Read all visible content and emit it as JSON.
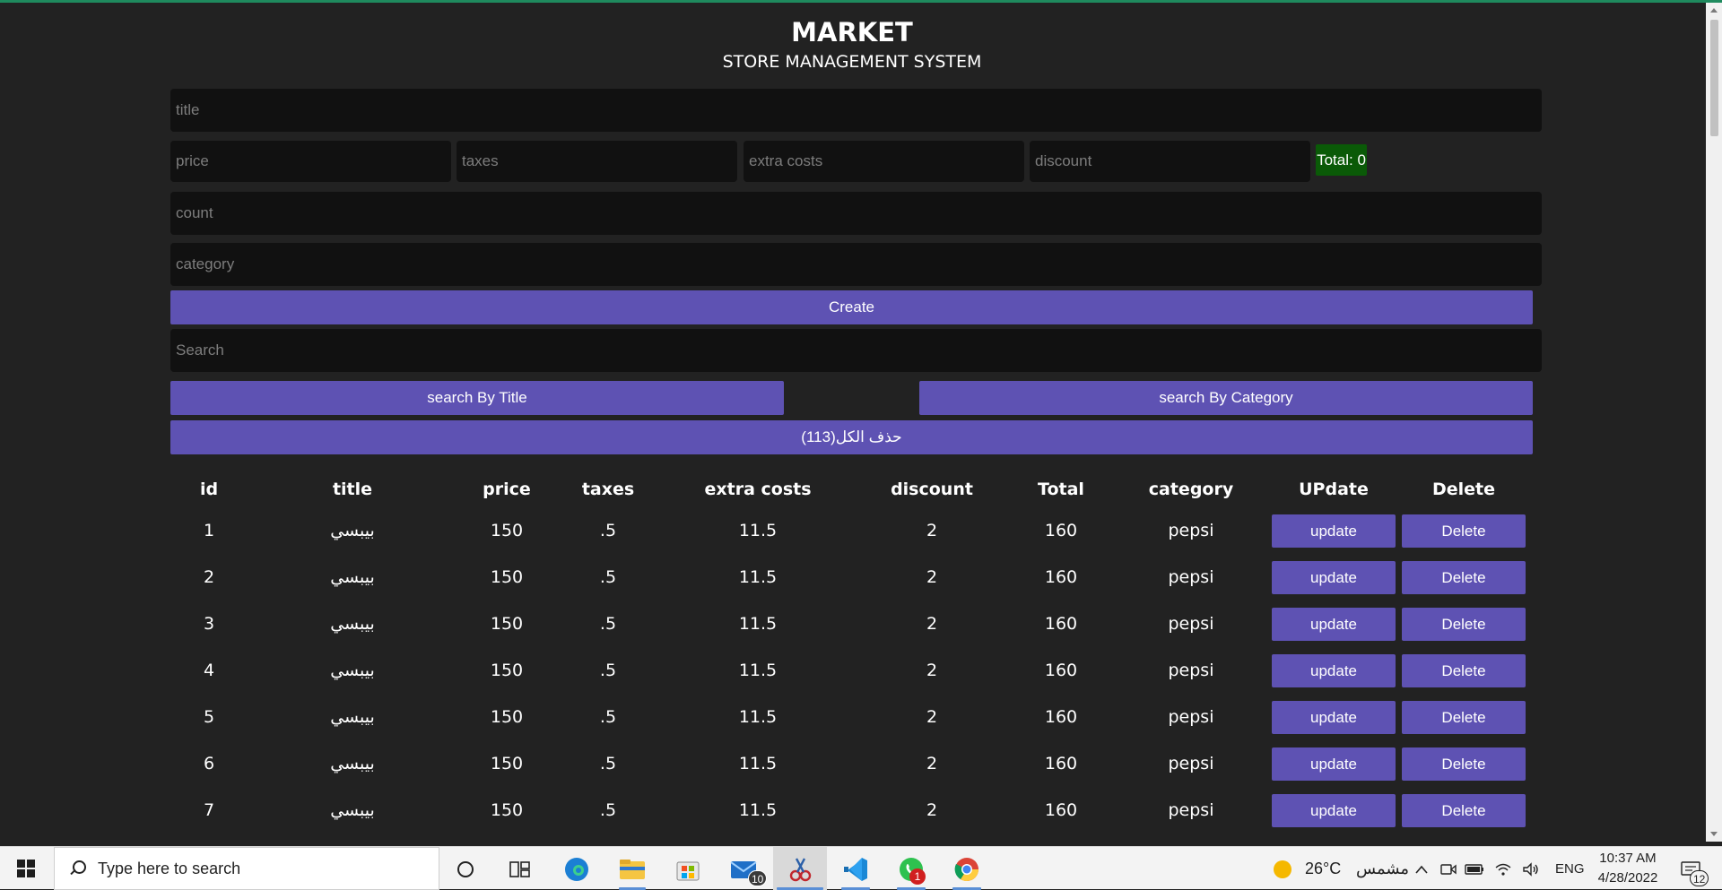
{
  "header": {
    "title": "MARKET",
    "subtitle": "STORE MANAGEMENT SYSTEM"
  },
  "form": {
    "title_placeholder": "title",
    "price_placeholder": "price",
    "taxes_placeholder": "taxes",
    "extra_costs_placeholder": "extra costs",
    "discount_placeholder": "discount",
    "total_label": "Total: 0",
    "count_placeholder": "count",
    "category_placeholder": "category",
    "create_label": "Create",
    "search_placeholder": "Search",
    "search_by_title_label": "search By Title",
    "search_by_category_label": "search By Category",
    "delete_all_label": "حذف الكل(113)"
  },
  "colors": {
    "background": "#222222",
    "input_bg": "#111111",
    "button": "#5e52b3",
    "total_bg": "#0a5a07"
  },
  "table": {
    "headers": [
      "id",
      "title",
      "price",
      "taxes",
      "extra costs",
      "discount",
      "Total",
      "category",
      "UPdate",
      "Delete"
    ],
    "update_label": "update",
    "delete_label": "Delete",
    "rows": [
      [
        "1",
        "بيبسي",
        "150",
        ".5",
        "11.5",
        "2",
        "160",
        "pepsi"
      ],
      [
        "2",
        "بيبسي",
        "150",
        ".5",
        "11.5",
        "2",
        "160",
        "pepsi"
      ],
      [
        "3",
        "بيبسي",
        "150",
        ".5",
        "11.5",
        "2",
        "160",
        "pepsi"
      ],
      [
        "4",
        "بيبسي",
        "150",
        ".5",
        "11.5",
        "2",
        "160",
        "pepsi"
      ],
      [
        "5",
        "بيبسي",
        "150",
        ".5",
        "11.5",
        "2",
        "160",
        "pepsi"
      ],
      [
        "6",
        "بيبسي",
        "150",
        ".5",
        "11.5",
        "2",
        "160",
        "pepsi"
      ],
      [
        "7",
        "بيبسي",
        "150",
        ".5",
        "11.5",
        "2",
        "160",
        "pepsi"
      ]
    ]
  },
  "taskbar": {
    "search_placeholder": "Type here to search",
    "apps": [
      "cortana-icon",
      "task-view-icon",
      "edge-icon",
      "file-explorer-icon",
      "store-icon",
      "mail-icon",
      "snipping-tool-icon",
      "vscode-icon",
      "whatsapp-icon",
      "chrome-icon"
    ],
    "mail_badge": "10",
    "whatsapp_badge": "1",
    "weather_temp": "26°C",
    "weather_text": "مشمس",
    "language": "ENG",
    "time": "10:37 AM",
    "date": "4/28/2022",
    "notifications": "12"
  }
}
